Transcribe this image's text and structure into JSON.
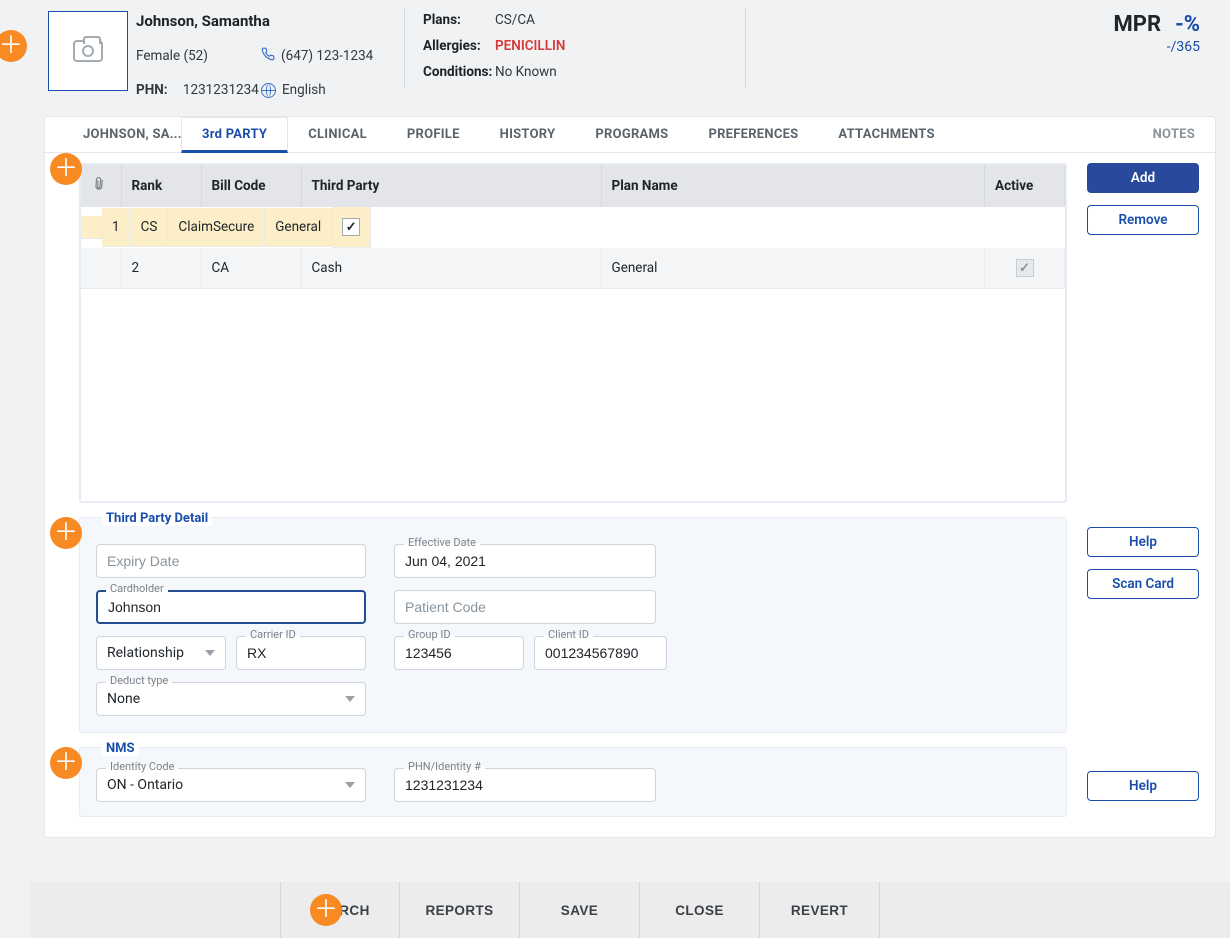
{
  "header": {
    "name": "Johnson, Samantha",
    "sex_age": "Female (52)",
    "phn_label": "PHN:",
    "phn": "1231231234",
    "phone": "(647) 123-1234",
    "language": "English",
    "plans_label": "Plans:",
    "plans": "CS/CA",
    "allergies_label": "Allergies:",
    "allergies": "PENICILLIN",
    "conditions_label": "Conditions:",
    "conditions": "No Known",
    "mpr_label": "MPR",
    "mpr_value": "-%",
    "mpr_sub": "-/365"
  },
  "tabs": {
    "patient": "JOHNSON, SA...",
    "thirdparty": "3rd PARTY",
    "clinical": "CLINICAL",
    "profile": "PROFILE",
    "history": "HISTORY",
    "programs": "PROGRAMS",
    "preferences": "PREFERENCES",
    "attachments": "ATTACHMENTS",
    "notes": "NOTES"
  },
  "actions": {
    "add": "Add",
    "remove": "Remove",
    "help": "Help",
    "scan_card": "Scan Card"
  },
  "table": {
    "headers": {
      "rank": "Rank",
      "billcode": "Bill Code",
      "thirdparty": "Third Party",
      "plan": "Plan Name",
      "active": "Active"
    },
    "rows": [
      {
        "rank": "1",
        "billcode": "CS",
        "thirdparty": "ClaimSecure",
        "plan": "General",
        "active": true,
        "selected": true,
        "active_enabled": true
      },
      {
        "rank": "2",
        "billcode": "CA",
        "thirdparty": "Cash",
        "plan": "General",
        "active": true,
        "selected": false,
        "active_enabled": false
      }
    ]
  },
  "detail": {
    "legend": "Third Party Detail",
    "expiry_placeholder": "Expiry Date",
    "effective_label": "Effective Date",
    "effective_value": "Jun 04, 2021",
    "cardholder_label": "Cardholder",
    "cardholder_value": "Johnson",
    "patient_code_placeholder": "Patient Code",
    "relationship_placeholder": "Relationship",
    "carrier_id_label": "Carrier ID",
    "carrier_id_value": "RX",
    "group_id_label": "Group ID",
    "group_id_value": "123456",
    "client_id_label": "Client ID",
    "client_id_value": "001234567890",
    "deduct_label": "Deduct type",
    "deduct_value": "None"
  },
  "nms": {
    "legend": "NMS",
    "identity_code_label": "Identity Code",
    "identity_code_value": "ON - Ontario",
    "phn_label": "PHN/Identity #",
    "phn_value": "1231231234"
  },
  "bottom": {
    "search": "SEARCH",
    "reports": "REPORTS",
    "save": "SAVE",
    "close": "CLOSE",
    "revert": "REVERT"
  }
}
